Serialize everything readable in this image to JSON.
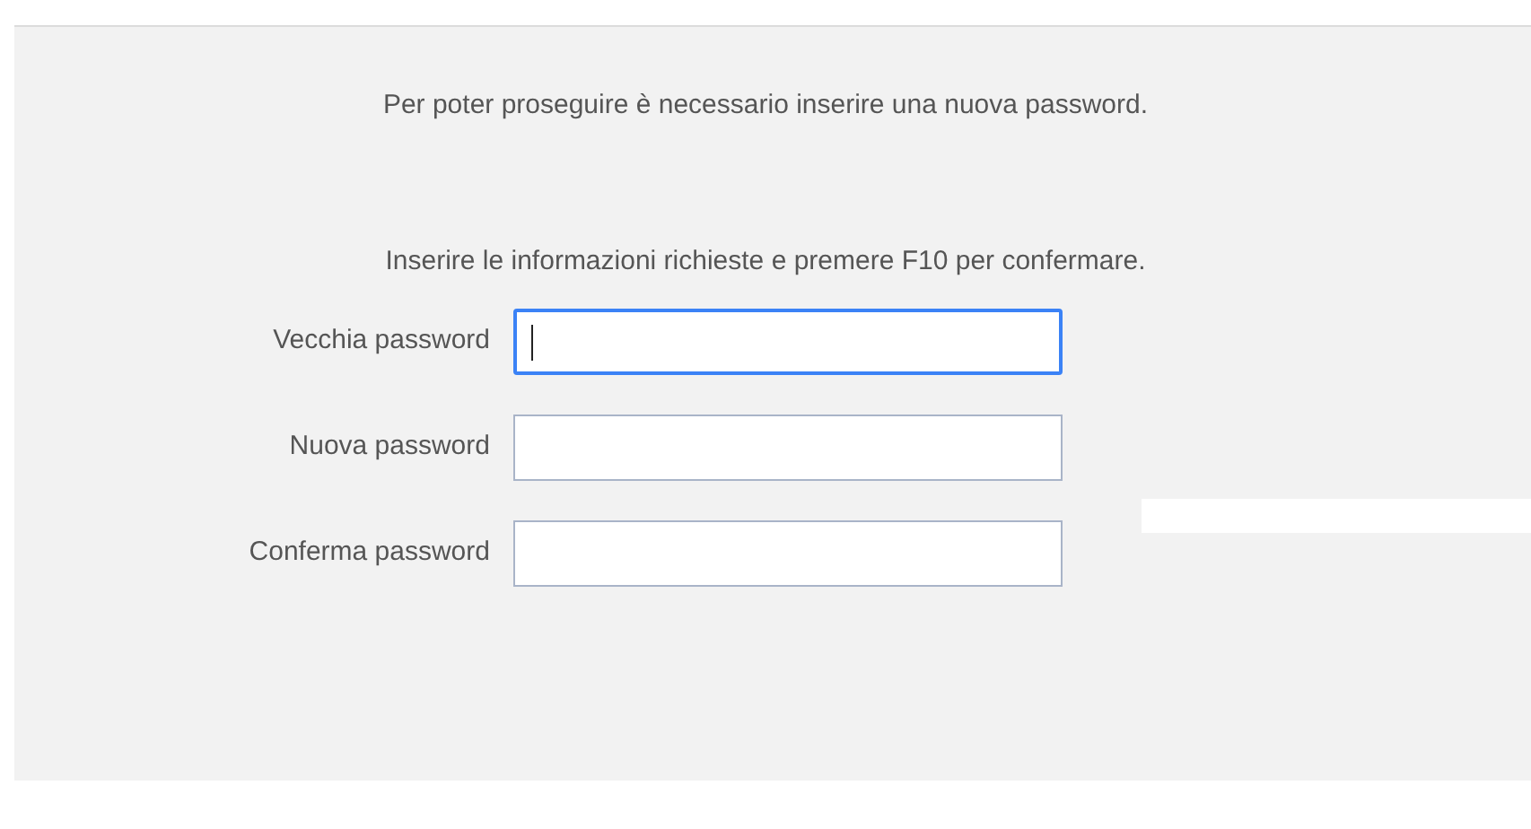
{
  "messages": [
    "Per poter proseguire è necessario inserire una nuova password.",
    "Inserire le informazioni richieste e premere F10 per confermare."
  ],
  "fields": [
    {
      "label": "Vecchia password",
      "focused": true
    },
    {
      "label": "Nuova password",
      "focused": false
    },
    {
      "label": "Conferma password",
      "focused": false
    }
  ]
}
